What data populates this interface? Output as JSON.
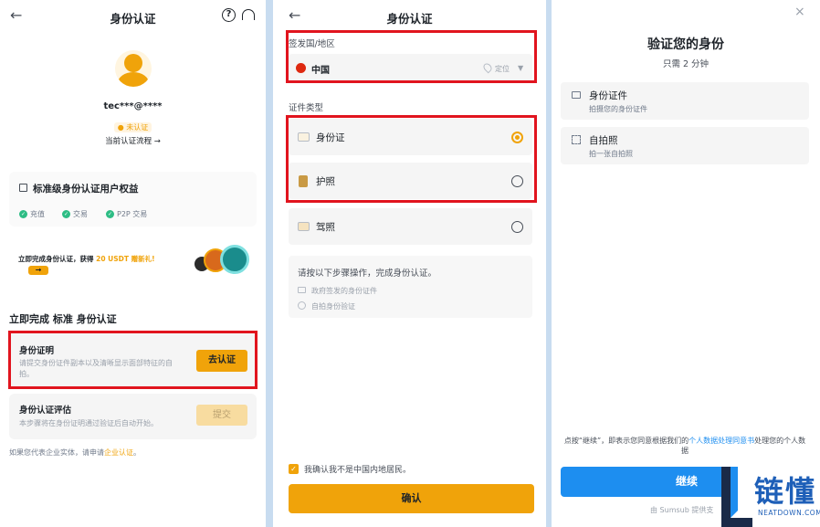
{
  "panel1": {
    "title": "身份认证",
    "username": "tec***@****",
    "status_badge": "未认证",
    "process_link": "当前认证流程 →",
    "benefits_title": "标准级身份认证用户权益",
    "benefits": [
      "充值",
      "交易",
      "P2P 交易"
    ],
    "promo_prefix": "立即完成身份认证，获得 ",
    "promo_highlight": "20 USDT 赠新礼!",
    "promo_arrow": "→",
    "section_title": "立即完成 标准 身份认证",
    "id_proof_title": "身份证明",
    "id_proof_desc": "请提交身份证件副本以及清晰显示面部特征的自拍。",
    "id_proof_button": "去认证",
    "assessment_title": "身份认证评估",
    "assessment_desc": "本步骤将在身份证明通过验证后自动开始。",
    "assessment_button": "提交",
    "footer_prefix": "如果您代表企业实体，请申请",
    "footer_link": "企业认证",
    "footer_suffix": "。"
  },
  "panel2": {
    "title": "身份认证",
    "country_label": "签发国/地区",
    "country_value": "中国",
    "locate_label": "定位",
    "doc_type_label": "证件类型",
    "doc_types": [
      {
        "label": "身份证",
        "selected": true
      },
      {
        "label": "护照",
        "selected": false
      },
      {
        "label": "驾照",
        "selected": false
      }
    ],
    "steps_title": "请按以下步骤操作，完成身份认证。",
    "steps": [
      "政府签发的身份证件",
      "自拍身份验证"
    ],
    "confirm_checkbox_label": "我确认我不是中国内地居民。",
    "confirm_button": "确认"
  },
  "panel3": {
    "title": "验证您的身份",
    "subtitle": "只需 2 分钟",
    "options": [
      {
        "title": "身份证件",
        "desc": "拍摄您的身份证件",
        "icon": "id-card-icon"
      },
      {
        "title": "自拍照",
        "desc": "拍一张自拍照",
        "icon": "selfie-icon"
      }
    ],
    "consent_prefix": "点按“继续”，即表示您同意根据我们的",
    "consent_link": "个人数据处理同意书",
    "consent_suffix": "处理您的个人数据",
    "continue_button": "继续",
    "powered_by": "由 Sumsub 提供支"
  },
  "watermark": {
    "brand": "链懂",
    "domain": "NEATDOWN.COM"
  },
  "colors": {
    "accent_yellow": "#f0a30a",
    "highlight_red": "#e1141e",
    "primary_blue": "#1d8ef0",
    "success_green": "#2ebd85"
  }
}
